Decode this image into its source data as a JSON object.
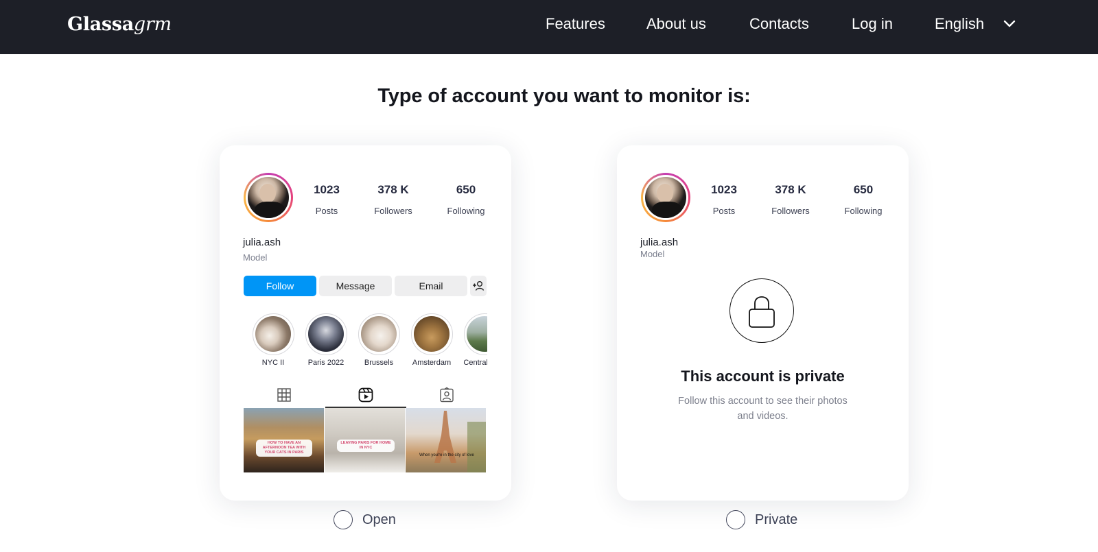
{
  "header": {
    "logo_bold": "Glassa",
    "logo_italic": "grm",
    "nav": [
      "Features",
      "About us",
      "Contacts",
      "Log in"
    ],
    "language": "English"
  },
  "page_title": "Type of account you want to monitor is:",
  "profile": {
    "username": "julia.ash",
    "role": "Model",
    "stats": [
      {
        "value": "1023",
        "label": "Posts"
      },
      {
        "value": "378 K",
        "label": "Followers"
      },
      {
        "value": "650",
        "label": "Following"
      }
    ],
    "buttons": {
      "follow": "Follow",
      "message": "Message",
      "email": "Email"
    },
    "highlights": [
      "NYC II",
      "Paris 2022",
      "Brussels",
      "Amsterdam",
      "Central Park"
    ],
    "posts": [
      {
        "caption": "HOW TO HAVE AN AFTERNOON TEA WITH YOUR CATS IN PARIS"
      },
      {
        "caption": "LEAVING PARIS FOR HOME IN NYC"
      },
      {
        "caption": "When you're in the city of love"
      }
    ]
  },
  "private_card": {
    "title": "This account is private",
    "subtitle": "Follow this account to see their photos and videos."
  },
  "options": {
    "open": "Open",
    "private": "Private"
  },
  "colors": {
    "topbar": "#1d1f27",
    "follow_button": "#0095f6",
    "accent_text": "#262a3f"
  }
}
